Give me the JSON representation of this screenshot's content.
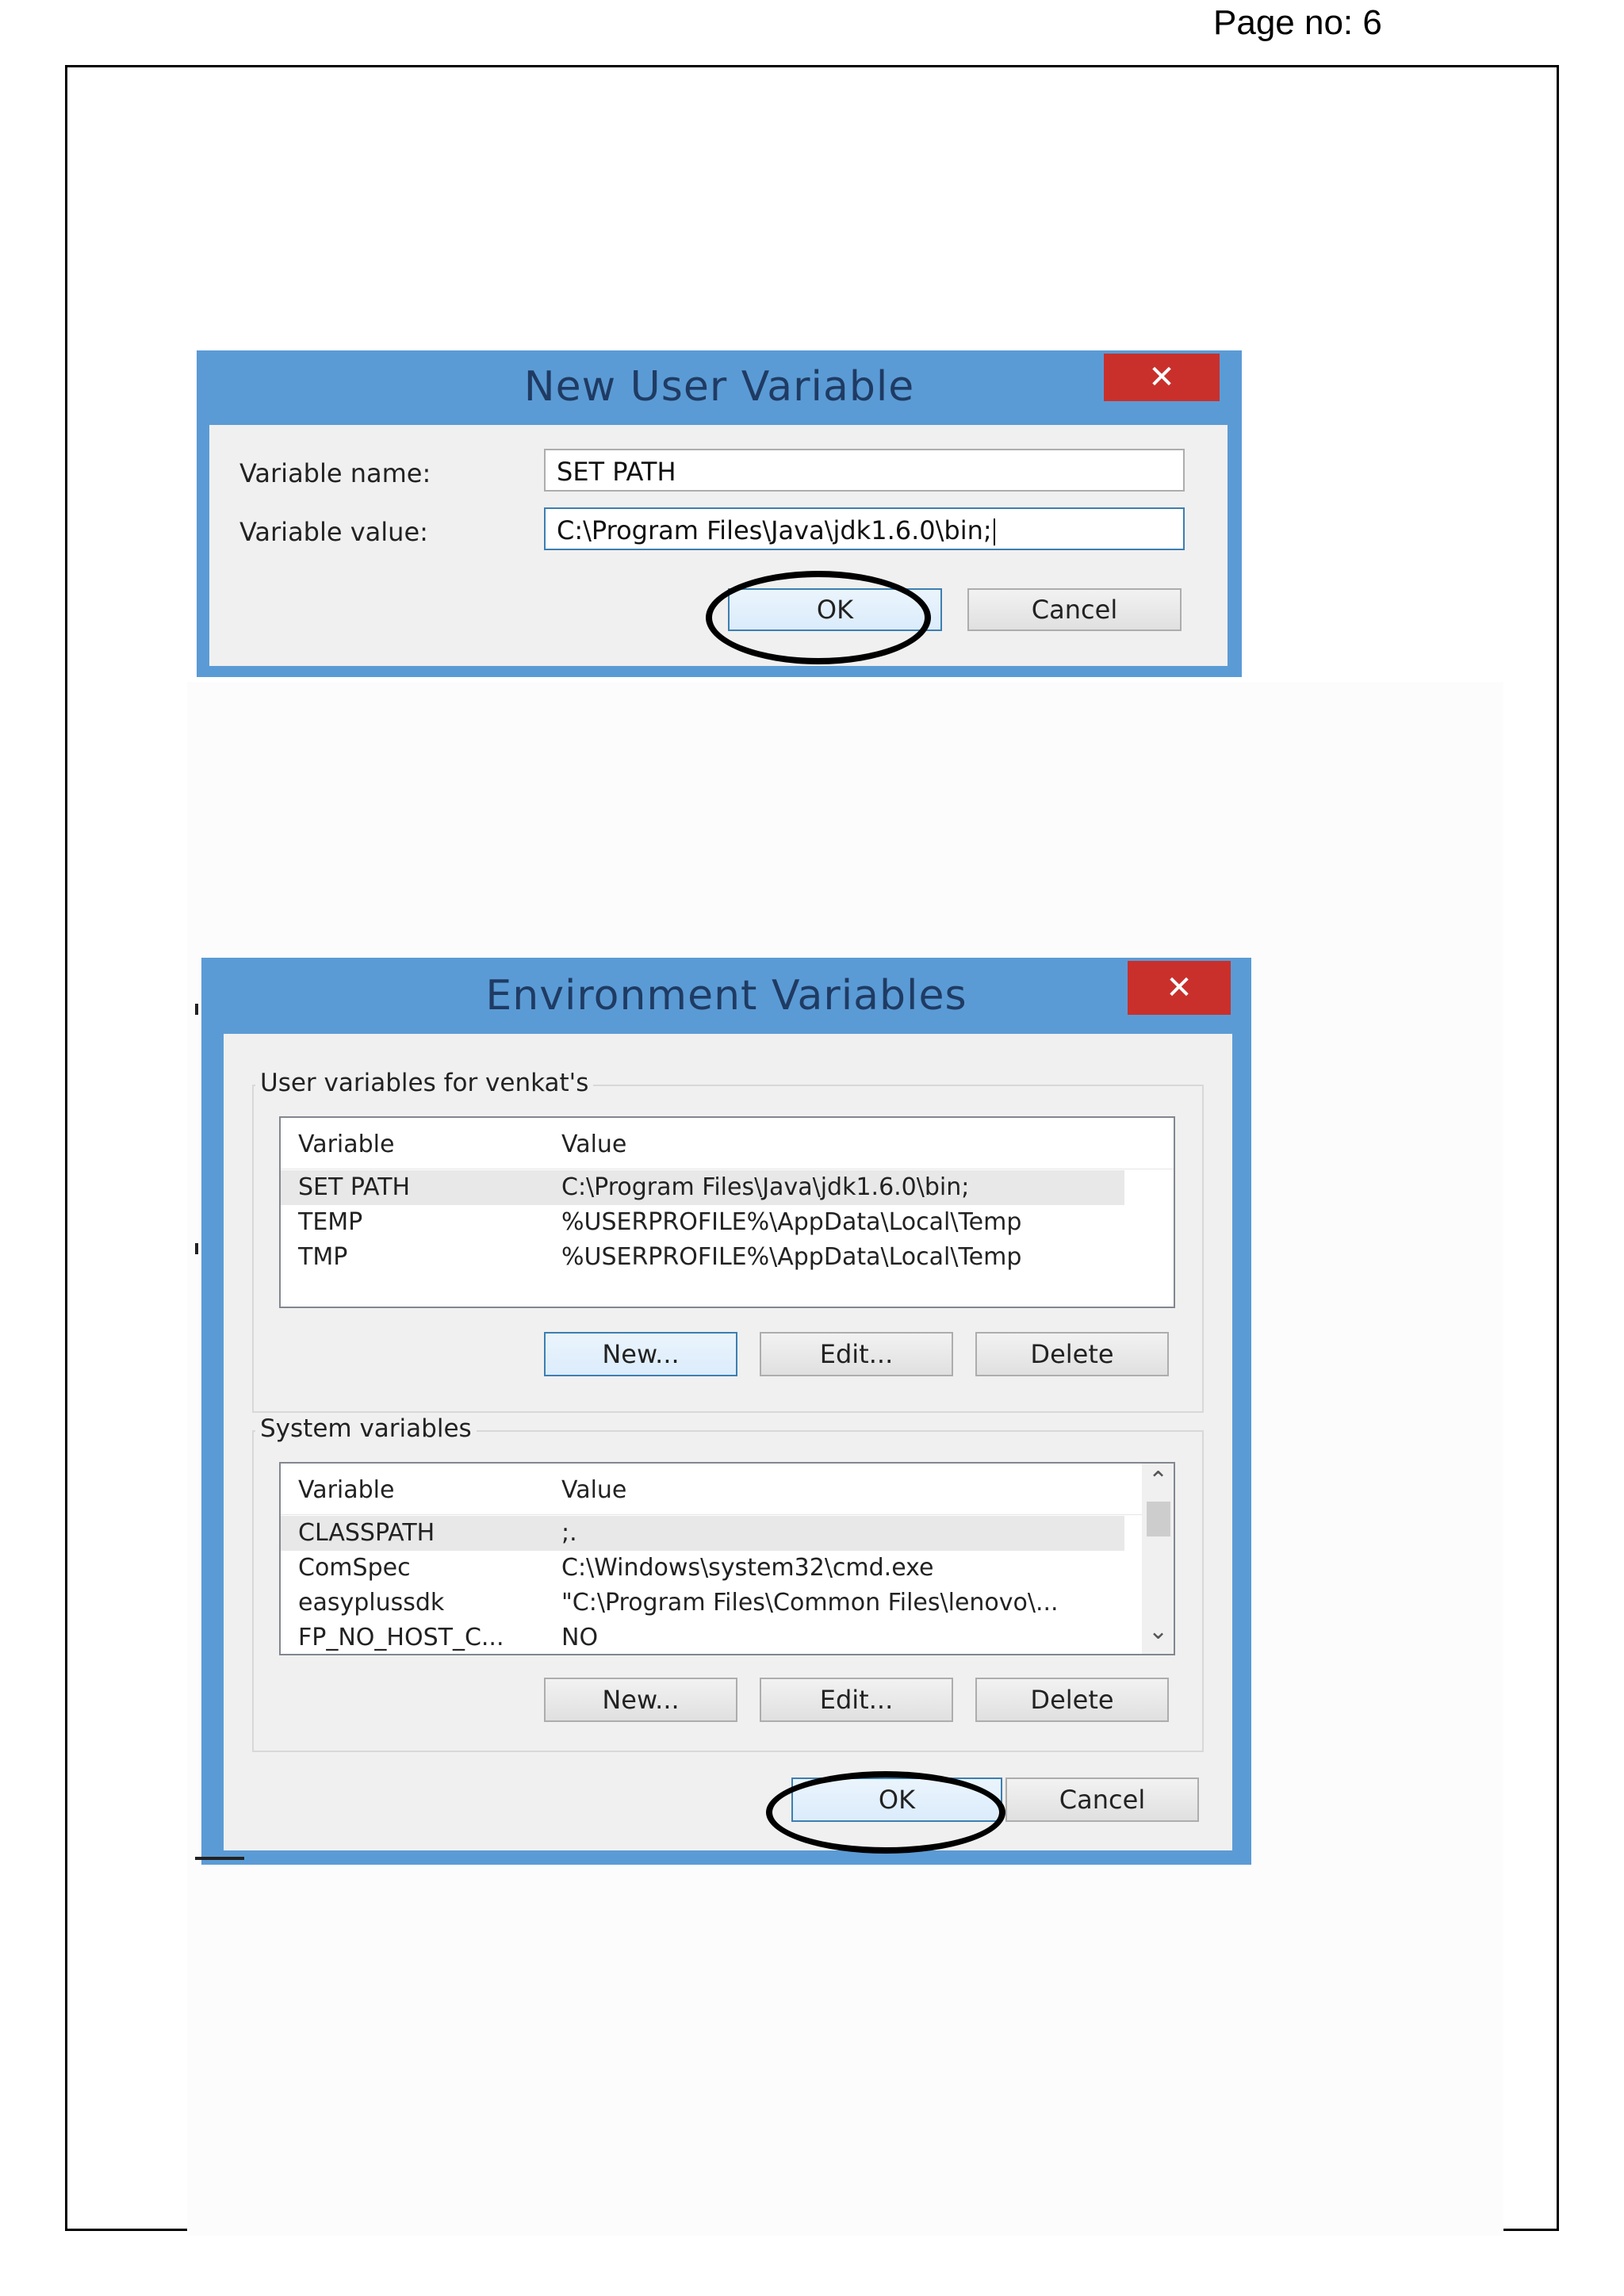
{
  "page": {
    "page_no": "Page no: 6"
  },
  "new_user_variable": {
    "title": "New User Variable",
    "close_glyph": "✕",
    "name_label": "Variable name:",
    "name_value": "SET PATH",
    "value_label": "Variable value:",
    "value_value": "C:\\Program Files\\Java\\jdk1.6.0\\bin;",
    "ok_label": "OK",
    "cancel_label": "Cancel"
  },
  "environment_variables": {
    "title": "Environment Variables",
    "close_glyph": "✕",
    "user_group_label": "User variables for venkat's",
    "user_headers": {
      "variable": "Variable",
      "value": "Value"
    },
    "user_rows": [
      {
        "variable": "SET PATH",
        "value": "C:\\Program Files\\Java\\jdk1.6.0\\bin;"
      },
      {
        "variable": "TEMP",
        "value": "%USERPROFILE%\\AppData\\Local\\Temp"
      },
      {
        "variable": "TMP",
        "value": "%USERPROFILE%\\AppData\\Local\\Temp"
      }
    ],
    "user_new": "New...",
    "user_edit": "Edit...",
    "user_delete": "Delete",
    "system_group_label": "System variables",
    "system_headers": {
      "variable": "Variable",
      "value": "Value"
    },
    "system_rows": [
      {
        "variable": "CLASSPATH",
        "value": ";."
      },
      {
        "variable": "ComSpec",
        "value": "C:\\Windows\\system32\\cmd.exe"
      },
      {
        "variable": "easyplussdk",
        "value": "\"C:\\Program Files\\Common Files\\lenovo\\..."
      },
      {
        "variable": "FP_NO_HOST_C...",
        "value": "NO"
      }
    ],
    "system_new": "New...",
    "system_edit": "Edit...",
    "system_delete": "Delete",
    "ok_label": "OK",
    "cancel_label": "Cancel"
  },
  "colors": {
    "title_bar": "#5b9bd5",
    "close_button": "#c9302c",
    "client_bg": "#f0f0f0",
    "highlight_ellipse": "#000000"
  },
  "icons": {
    "close": "close-icon",
    "scroll_up": "chevron-up-icon",
    "scroll_down": "chevron-down-icon"
  }
}
